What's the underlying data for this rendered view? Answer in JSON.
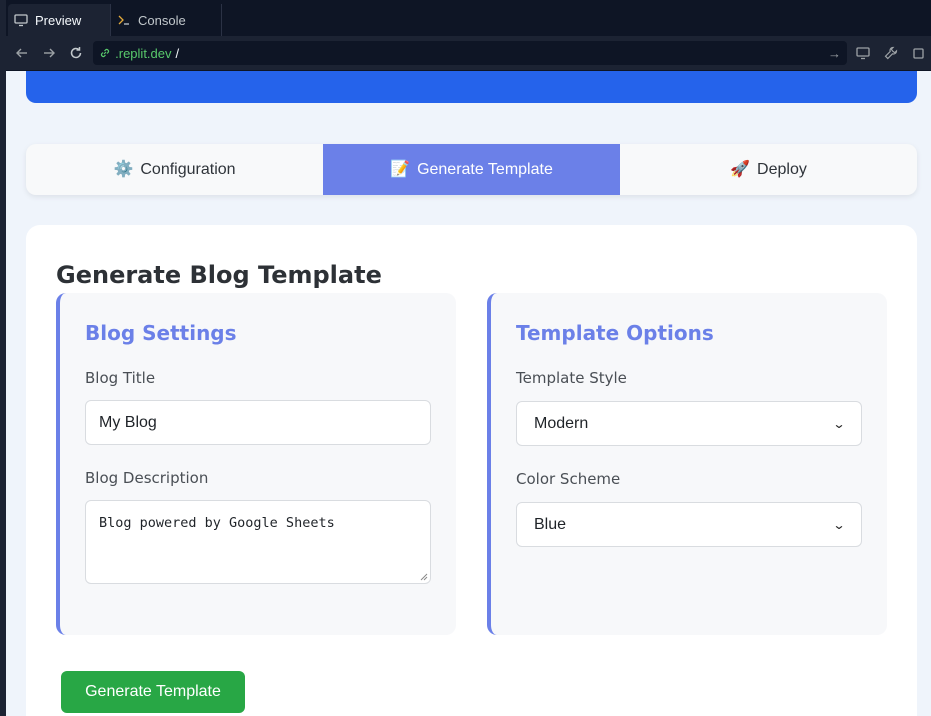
{
  "ide": {
    "tabs": [
      {
        "label": "Preview",
        "icon": "monitor-icon"
      },
      {
        "label": "Console",
        "icon": "terminal-icon"
      }
    ],
    "url": {
      "host": ".replit.dev",
      "path": "/"
    }
  },
  "app": {
    "nav_tabs": [
      {
        "emoji": "⚙️",
        "label": "Configuration"
      },
      {
        "emoji": "📝",
        "label": "Generate Template"
      },
      {
        "emoji": "🚀",
        "label": "Deploy"
      }
    ],
    "active_tab": "Generate Template",
    "section_title": "Generate Blog Template",
    "blog_settings": {
      "title": "Blog Settings",
      "blog_title_label": "Blog Title",
      "blog_title_value": "My Blog",
      "blog_description_label": "Blog Description",
      "blog_description_value": "Blog powered by Google Sheets"
    },
    "template_options": {
      "title": "Template Options",
      "style_label": "Template Style",
      "style_value": "Modern",
      "color_label": "Color Scheme",
      "color_value": "Blue"
    },
    "generate_button": "Generate Template"
  },
  "colors": {
    "accent": "#6b80e8",
    "header_blue": "#2563eb",
    "button_green": "#28a745",
    "page_bg": "#eff4fb"
  }
}
